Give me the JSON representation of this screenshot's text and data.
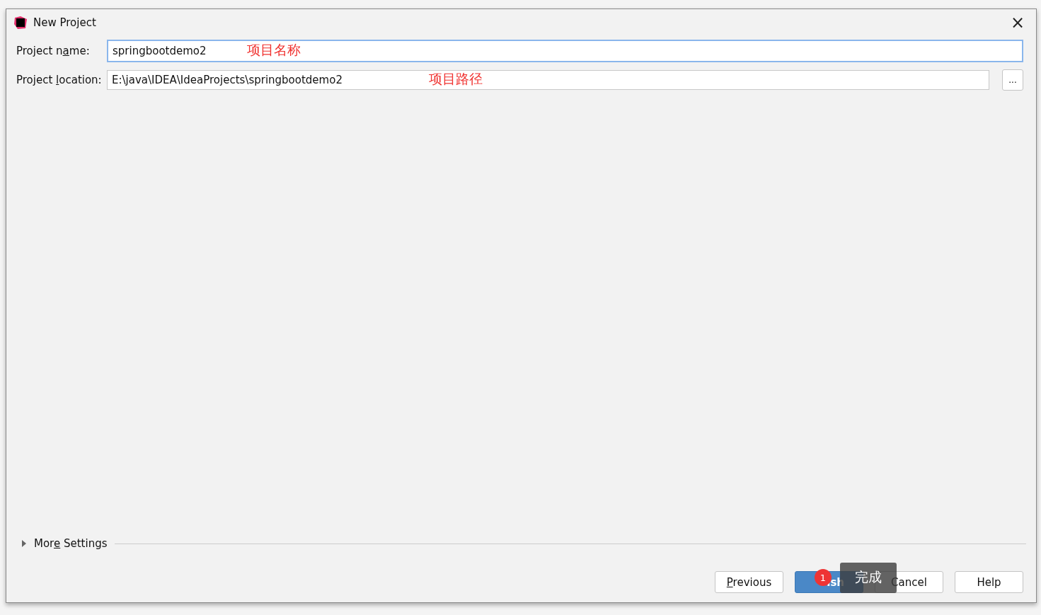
{
  "window": {
    "title": "New Project",
    "close": "×"
  },
  "fields": [
    {
      "kind": "text",
      "label": {
        "before": "Project n",
        "key": "a",
        "after": "me:"
      },
      "value": "springbootdemo2",
      "focused": true,
      "annotation": "项目名称"
    },
    {
      "kind": "browse",
      "label": {
        "before": "Project ",
        "key": "l",
        "after": "ocation:"
      },
      "value": "E:\\java\\IDEA\\IdeaProjects\\springbootdemo2",
      "focused": false,
      "annotation": "项目路径",
      "browse": "..."
    }
  ],
  "more_settings": {
    "label": {
      "before": "Mor",
      "key": "e",
      "after": " Settings"
    },
    "expanded": false
  },
  "buttons": [
    {
      "label": {
        "key": "P",
        "after": "revious"
      },
      "primary": false
    },
    {
      "label": {
        "after": "ish"
      },
      "primary": true
    },
    {
      "label": {
        "after": "Cancel"
      },
      "primary": false
    },
    {
      "label": {
        "after": "Help"
      },
      "primary": false
    }
  ],
  "tooltip": {
    "badge": "1",
    "text": "完成"
  }
}
